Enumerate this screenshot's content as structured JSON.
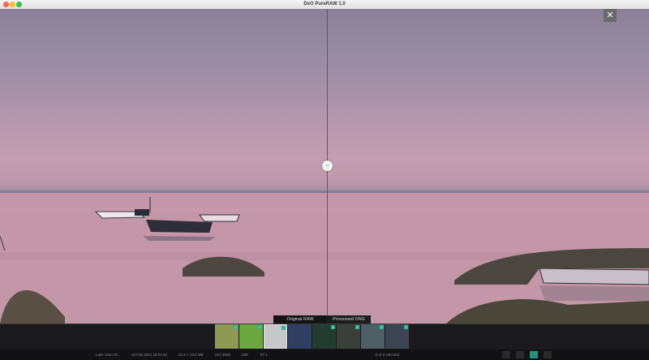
{
  "window": {
    "title": "DxO PureRAW 1.0"
  },
  "viewer": {
    "close_label": "✕",
    "handle_glyph": "⇔",
    "left_label": "Original RAW",
    "right_label": "Processed DNG"
  },
  "filmstrip": {
    "thumbnails": [
      {
        "name": "thumb-1",
        "badge": "✓",
        "selected": false,
        "color": "#8e9a52"
      },
      {
        "name": "thumb-2",
        "badge": "✓",
        "selected": false,
        "color": "#6aa73e"
      },
      {
        "name": "thumb-3",
        "badge": "✓",
        "selected": true,
        "color": "#c5c7c9"
      },
      {
        "name": "thumb-4",
        "badge": "",
        "selected": false,
        "color": "#2f3e63"
      },
      {
        "name": "thumb-5",
        "badge": "✓",
        "selected": false,
        "color": "#223c2f"
      },
      {
        "name": "thumb-6",
        "badge": "✓",
        "selected": false,
        "color": "#3b3f3a"
      },
      {
        "name": "thumb-7",
        "badge": "✓",
        "selected": false,
        "color": "#4f5f66"
      },
      {
        "name": "thumb-8",
        "badge": "✓",
        "selected": false,
        "color": "#3d4554"
      }
    ]
  },
  "status": {
    "filename": "Lake Jean Ol...",
    "date": "16 Feb 2021 19:04:54",
    "size": "42.3 × 73.6 MB",
    "iso": "ISO 2000",
    "shutter": "1/80",
    "aperture": "f/7.1",
    "selection": "0 of 8 selected"
  },
  "colors": {
    "accent": "#2bb59a"
  }
}
